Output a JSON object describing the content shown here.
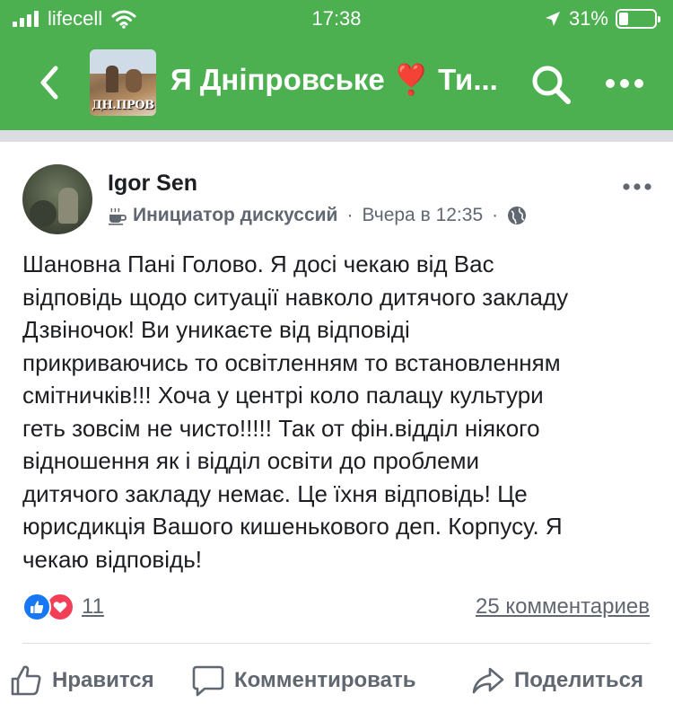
{
  "status_bar": {
    "carrier": "lifecell",
    "time": "17:38",
    "battery": "31%",
    "battery_level": 0.31
  },
  "header": {
    "group_title": "Я Дніпровське ❣️ Ти...",
    "group_avatar_text": "ДН.ПРОВ"
  },
  "post": {
    "author": "Igor Sen",
    "badge": "Инициатор дискуссий",
    "time": "Вчера в 12:35",
    "privacy_icon": "globe-icon",
    "text_lines": [
      "Шановна Пані Голово. Я досі чекаю від Вас",
      "відповідь щодо ситуації навколо дитячого закладу",
      "Дзвіночок! Ви уникаєте від відповіді",
      "прикриваючись то освітленням то встановленням",
      "смітничків!!! Хоча у центрі коло палацу культури",
      "геть зовсім не чисто!!!!! Так от фін.відділ ніякого",
      "відношення як і відділ освіти до проблеми",
      "дитячого закладу немає. Це їхня відповідь! Це",
      "юрисдикція Вашого кишенькового деп. Корпусу. Я",
      "чекаю відповідь!"
    ],
    "reactions_count": "11",
    "comments_count": "25 комментариев"
  },
  "actions": {
    "like": "Нравится",
    "comment": "Комментировать",
    "share": "Поделиться"
  },
  "colors": {
    "header_bg": "#4caf50",
    "like_blue": "#1877f2",
    "love_red": "#f33e58",
    "secondary_text": "#606770"
  }
}
